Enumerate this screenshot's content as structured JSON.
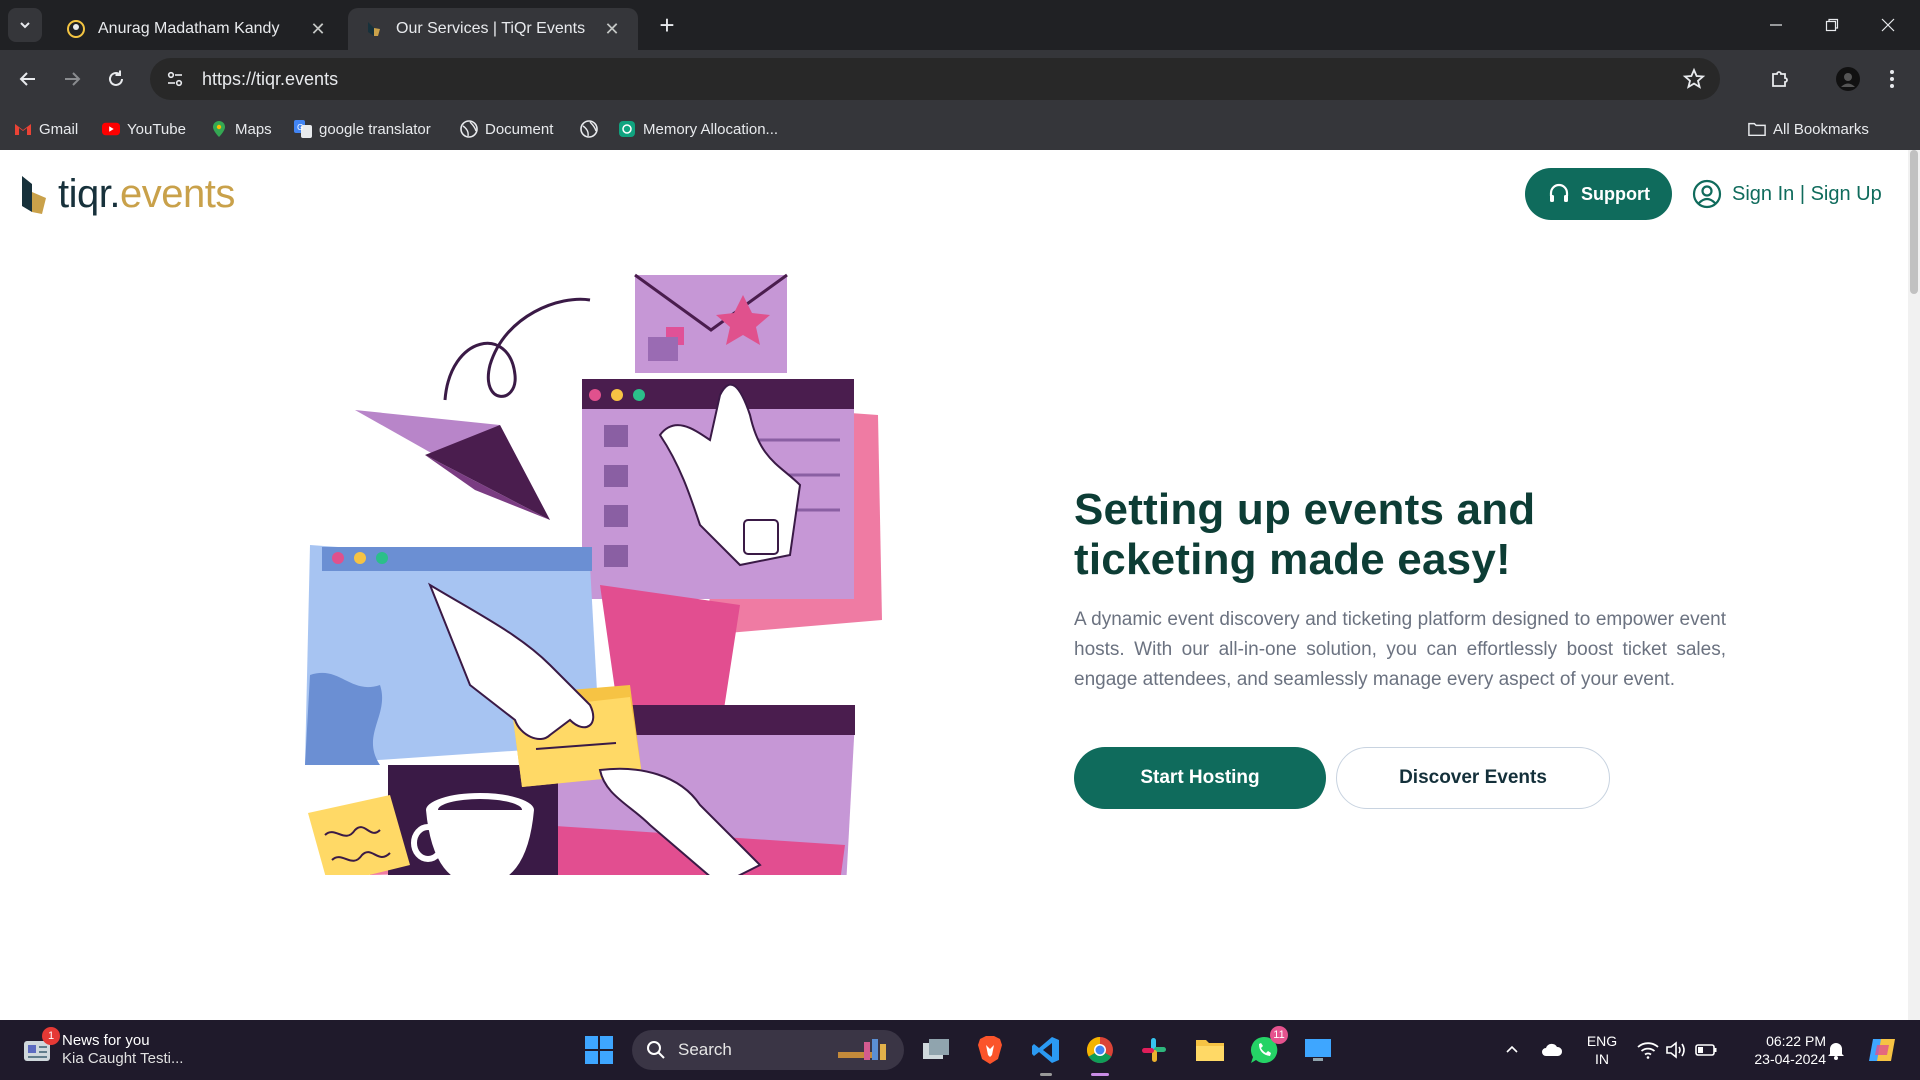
{
  "browser": {
    "tabs": [
      {
        "title": "Anurag Madatham Kandy"
      },
      {
        "title": "Our Services | TiQr Events"
      }
    ],
    "url": "https://tiqr.events",
    "bookmarks": [
      "Gmail",
      "YouTube",
      "Maps",
      "google translator",
      "Document",
      "Memory Allocation..."
    ],
    "all_bookmarks": "All Bookmarks"
  },
  "site": {
    "logo": {
      "part1": "tiqr.",
      "part2": "events"
    },
    "support": "Support",
    "signin": "Sign In | Sign Up",
    "hero": {
      "line1": "Setting up events and",
      "line2": "ticketing made easy!",
      "description": "A dynamic event discovery and ticketing platform designed to empower event hosts. With our all-in-one solution, you can effortlessly boost ticket sales, engage attendees, and seamlessly manage every aspect of your event.",
      "cta_primary": "Start Hosting",
      "cta_secondary": "Discover Events"
    },
    "colors": {
      "brand": "#0f6b5c",
      "accent": "#c9a14a"
    }
  },
  "taskbar": {
    "news_title": "News for you",
    "news_sub": "Kia Caught Testi...",
    "news_badge": "1",
    "search": "Search",
    "whatsapp_badge": "11",
    "lang1": "ENG",
    "lang2": "IN",
    "time": "06:22 PM",
    "date": "23-04-2024"
  }
}
